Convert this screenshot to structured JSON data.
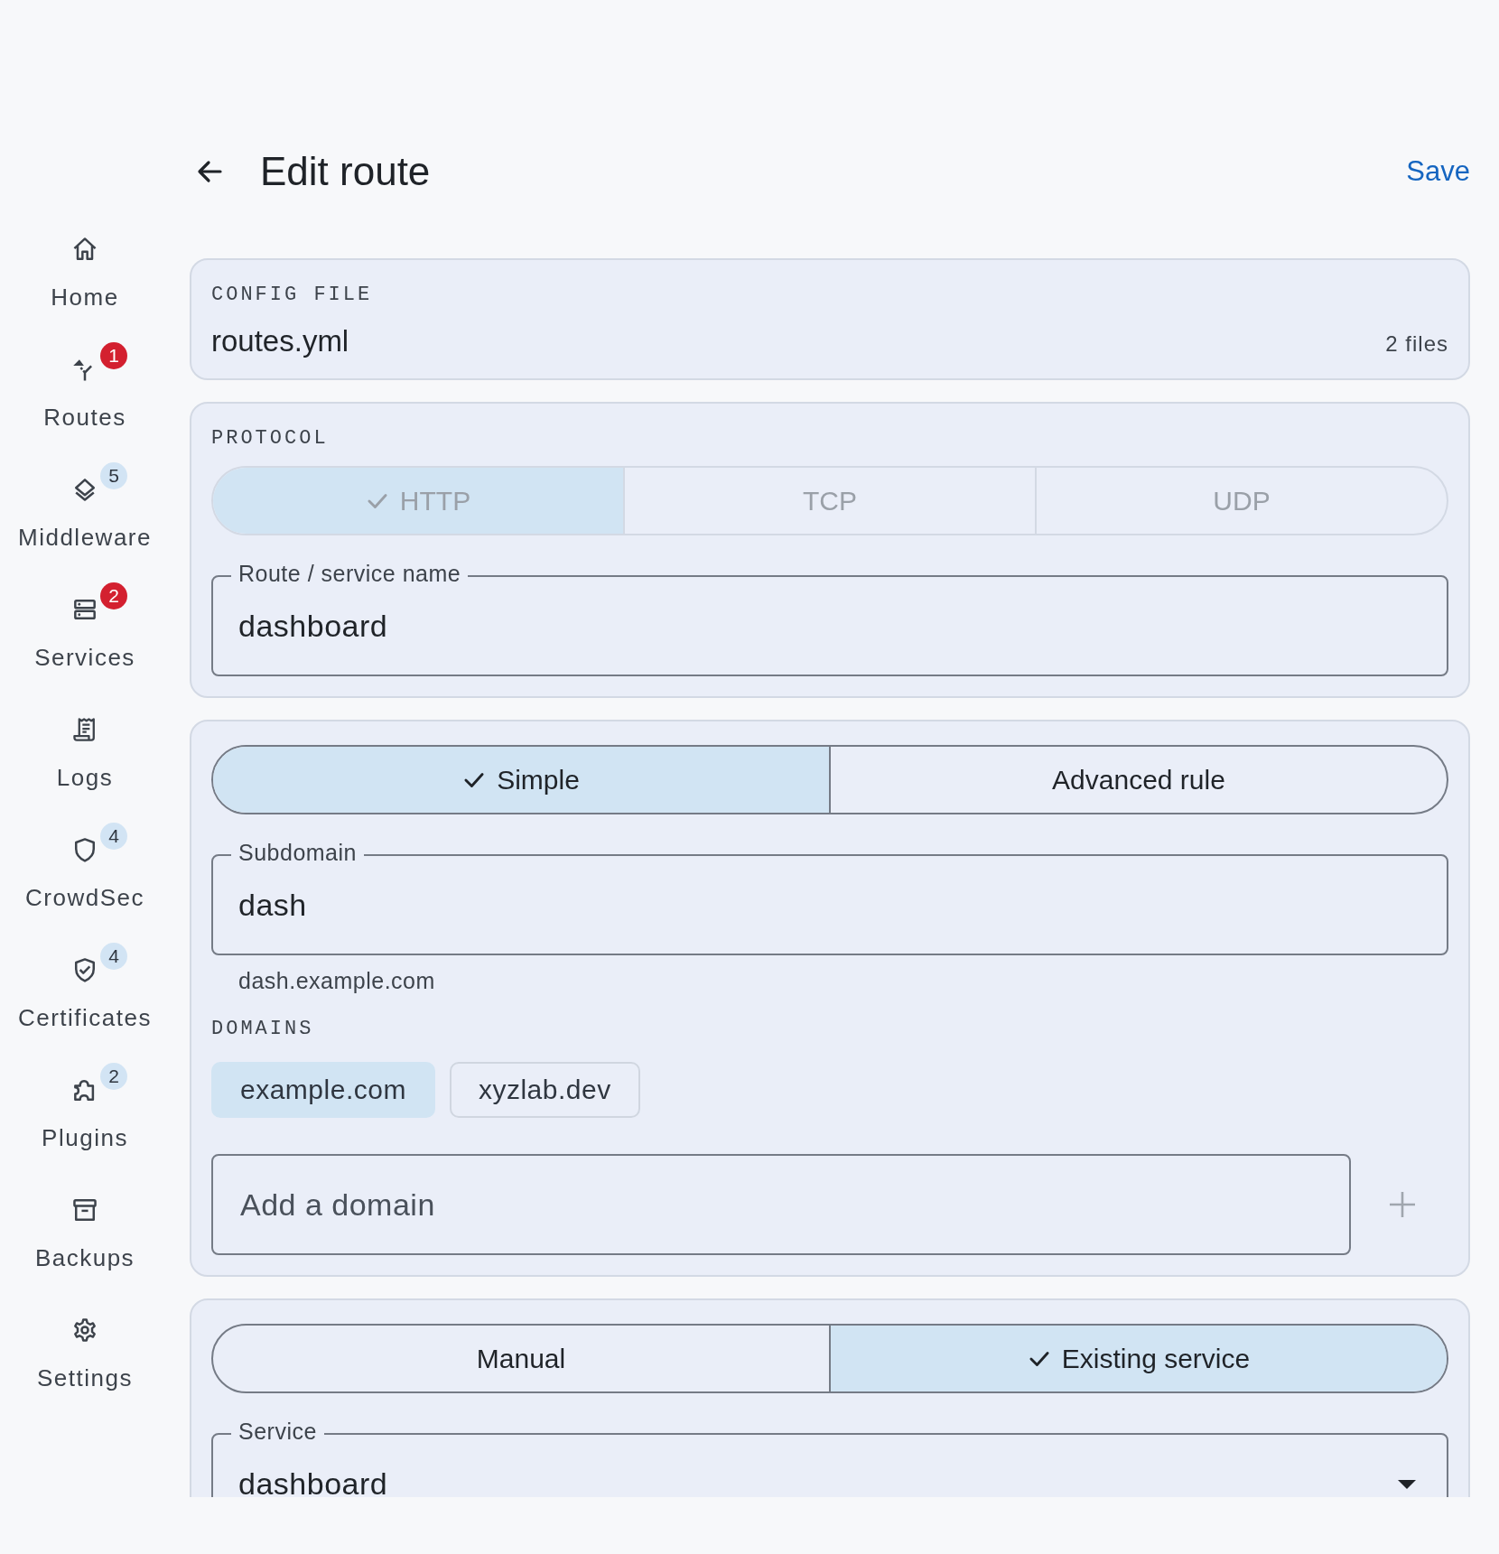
{
  "sidebar": {
    "items": [
      {
        "label": "Home"
      },
      {
        "label": "Routes",
        "badge": {
          "text": "1",
          "color": "#d3202f"
        }
      },
      {
        "label": "Middleware",
        "badge": {
          "text": "5",
          "color": "#d2e4f4"
        }
      },
      {
        "label": "Services",
        "badge": {
          "text": "2",
          "color": "#d3202f"
        }
      },
      {
        "label": "Logs"
      },
      {
        "label": "CrowdSec",
        "badge": {
          "text": "4",
          "color": "#d2e4f4"
        }
      },
      {
        "label": "Certificates",
        "badge": {
          "text": "4",
          "color": "#d2e4f4"
        }
      },
      {
        "label": "Plugins",
        "badge": {
          "text": "2",
          "color": "#d2e4f4"
        }
      },
      {
        "label": "Backups"
      },
      {
        "label": "Settings"
      }
    ]
  },
  "header": {
    "title": "Edit route",
    "action": "Save"
  },
  "config_file": {
    "label": "CONFIG FILE",
    "value": "routes.yml",
    "count": "2 files"
  },
  "protocol": {
    "label": "PROTOCOL",
    "disabled": true,
    "options": [
      {
        "label": "HTTP",
        "selected": true
      },
      {
        "label": "TCP",
        "selected": false
      },
      {
        "label": "UDP",
        "selected": false
      }
    ]
  },
  "name_field": {
    "label": "Route / service name",
    "value": "dashboard"
  },
  "match_mode": {
    "options": [
      {
        "label": "Simple",
        "selected": true
      },
      {
        "label": "Advanced rule",
        "selected": false
      }
    ]
  },
  "subdomain_field": {
    "label": "Subdomain",
    "value": "dash",
    "helper": "dash.example.com"
  },
  "domains": {
    "label": "DOMAINS",
    "chips": [
      {
        "label": "example.com",
        "selected": true
      },
      {
        "label": "xyzlab.dev",
        "selected": false
      }
    ],
    "add_field": {
      "placeholder": "Add a domain"
    }
  },
  "service_mode": {
    "options": [
      {
        "label": "Manual",
        "selected": false
      },
      {
        "label": "Existing service",
        "selected": true
      }
    ]
  },
  "service_field": {
    "label": "Service",
    "value": "dashboard"
  }
}
